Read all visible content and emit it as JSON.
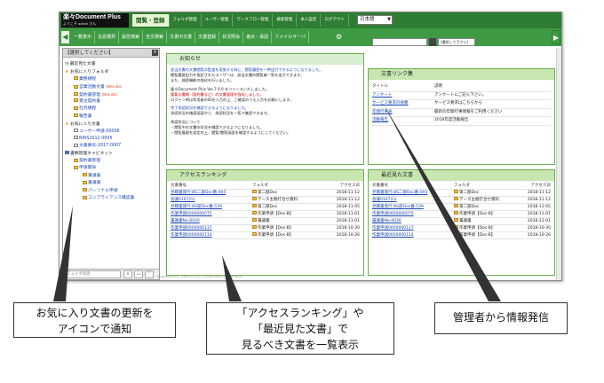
{
  "app": {
    "logo": "楽々Document Plus",
    "logo_sub": "ようこそ admin さん",
    "top_menu": [
      "閲覧・登録",
      "フォルダ管理",
      "ユーザー管理",
      "ワークフロー管理",
      "検索管理",
      "本人設定",
      "ログアウト"
    ],
    "language": "日本語"
  },
  "toolbar": {
    "items": [
      "一覧表示",
      "言語選択",
      "属性検索",
      "全文検索",
      "文書中文書",
      "文書登録",
      "状況照会",
      "差戻・承認",
      "ファイルサーバ"
    ],
    "approval_count": "1"
  },
  "left_panel": {
    "header": "【選択してください】",
    "tree": [
      {
        "label": "最近見た文書",
        "type": "clock"
      },
      {
        "label": "お気に入りフォルダ",
        "type": "star"
      },
      {
        "label": "業務規程",
        "type": "folder",
        "indent": 1
      },
      {
        "label": "営業活動文書",
        "type": "folder",
        "indent": 1,
        "tag": "New doc"
      },
      {
        "label": "契約書管理",
        "type": "folder",
        "indent": 1,
        "tag": "New doc"
      },
      {
        "label": "受注契約書",
        "type": "folder",
        "indent": 1
      },
      {
        "label": "社内規程",
        "type": "folder",
        "indent": 1
      },
      {
        "label": "報告書",
        "type": "folder",
        "indent": 1
      },
      {
        "label": "お気に入り文書",
        "type": "star"
      },
      {
        "label": "ユーザー申請-00006",
        "type": "doc",
        "indent": 1
      },
      {
        "label": "NWS2012-0005",
        "type": "doc",
        "indent": 1
      },
      {
        "label": "文書番号-2017-0007",
        "type": "doc",
        "indent": 1
      },
      {
        "label": "書類管理キャビネット",
        "type": "cab"
      },
      {
        "label": "契約書管理",
        "type": "folder",
        "indent": 1
      },
      {
        "label": "申請関係",
        "type": "folder",
        "indent": 1
      },
      {
        "label": "稟議書",
        "type": "folder",
        "indent": 2
      },
      {
        "label": "稟議書",
        "type": "folder",
        "indent": 2
      },
      {
        "label": "パーソナル申請",
        "type": "folder",
        "indent": 2
      },
      {
        "label": "コンプライアンス確認書",
        "type": "folder",
        "indent": 2
      }
    ],
    "search_placeholder": "フォルダ検索"
  },
  "news": {
    "title": "お知らせ",
    "lines": [
      {
        "t": "該当文書の文書閲覧の監査を実施する為に、閲覧履歴を一時出力できるようになりました。",
        "c": "blue"
      },
      {
        "t": "閲覧履歴出力を指定されたユーザーは、該当文書の閲覧者一覧を出力できます。",
        "c": ""
      },
      {
        "t": "また、検索機能の強化を行いました。",
        "c": ""
      },
      {
        "t": "楽々Document Plus Ver.7.0.0 をリリースいたしました。",
        "c": ""
      },
      {
        "t": "重要な書類（契約書など）の文書管理を強化しました。",
        "c": "red"
      },
      {
        "t": "ログイン時は利用者のIDを入力の上、ご確認のうえ入力をお願いします。",
        "c": ""
      },
      {
        "t": "完了承認状況を確認できるようになりました。",
        "c": "blue"
      },
      {
        "t": "承認状況の確認画面から、承認状況を一覧で確認できます。",
        "c": ""
      },
      {
        "t": "承認状況について",
        "c": ""
      },
      {
        "t": "・閲覧中の文書の状況を確認できるようになりました。",
        "c": ""
      },
      {
        "t": "・閲覧権限を設定の上、閲覧/閲覧画面を確認するようにしてください。",
        "c": ""
      }
    ]
  },
  "doc_links": {
    "title": "文書リンク集",
    "header": [
      "タイトル",
      "説明"
    ],
    "rows": [
      [
        "アンケート",
        "アンケートにご記入下さい。"
      ],
      [
        "サービス要求の依頼",
        "サービス要求はこちらから"
      ],
      [
        "年間行事表",
        "最新の年間行事情報をご利用ください"
      ],
      [
        "活動報告",
        "2018年度活動報告"
      ]
    ]
  },
  "ranking": {
    "title": "アクセスランキング",
    "header": [
      "文書番号",
      "フォルダ",
      "アクセス日"
    ],
    "rows": [
      [
        "見積書発行-BS二部Doc番-005",
        "第二部Doc",
        "2018-11-12"
      ],
      [
        "会議0167(G)",
        "データ主催打合せ資料",
        "2018-11-12"
      ],
      [
        "見積書発行-BS部Doc番-539",
        "第二部Doc",
        "2018-11-05"
      ],
      [
        "作業申請0000000075",
        "作業申請【Doc-B】",
        "2018-11-01"
      ],
      [
        "稟議書No-0030",
        "稟議書",
        "2018-11-01"
      ],
      [
        "作業申請0000000117",
        "作業申請【Doc-B】",
        "2018-10-30"
      ],
      [
        "作業申請0000000114",
        "作業申請【Doc-B】",
        "2018-10-26"
      ]
    ]
  },
  "recent": {
    "title": "最近見た文書",
    "header": [
      "文書番号",
      "フォルダ",
      "アクセス日"
    ],
    "rows": [
      [
        "見積書発行-BS二部Doc番-005",
        "第二部Doc",
        "2018-11-12"
      ],
      [
        "会議0167(G)",
        "データ主催打合せ資料",
        "2018-11-12"
      ],
      [
        "見積書発行-BS部Doc番-539",
        "第二部Doc",
        "2018-11-05"
      ],
      [
        "作業申請0000000075",
        "作業申請【Doc-B】",
        "2018-11-01"
      ],
      [
        "稟議書No-0030",
        "稟議書",
        "2018-11-01"
      ],
      [
        "作業申請0000000117",
        "作業申請【Doc-B】",
        "2018-10-30"
      ],
      [
        "作業申請0000000114",
        "作業申請【Doc-B】",
        "2018-10-26"
      ]
    ]
  },
  "search_select": "(選択して下さい)",
  "status_text": "dxdpb0000 User: admin/カスタム 1.0 Date 2018/11/13 16:05:23",
  "callouts": {
    "left_line1": "お気に入り文書の更新を",
    "left_line2": "アイコンで通知",
    "center_line1": "「アクセスランキング」や",
    "center_line2": "「最近見た文書」で",
    "center_line3": "見るべき文書を一覧表示",
    "right_line1": "管理者から情報発信"
  }
}
